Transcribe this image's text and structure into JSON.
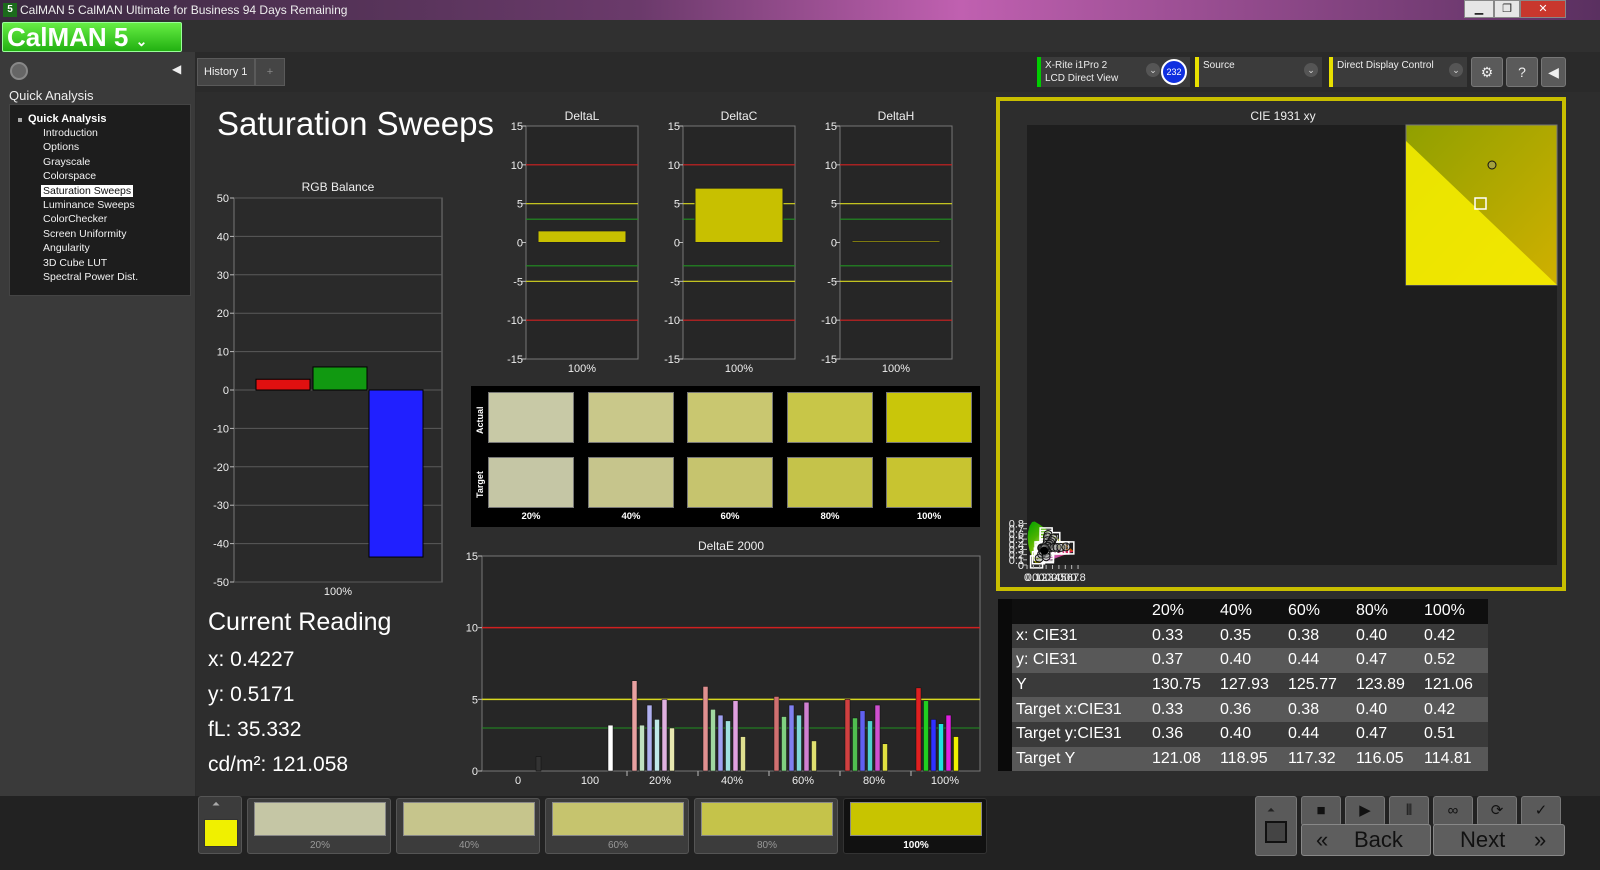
{
  "window": {
    "title": "CalMAN 5 CalMAN Ultimate for Business 94 Days Remaining",
    "app_icon": "5",
    "minimize": "▁",
    "maximize": "❐",
    "close": "✕"
  },
  "logo": "CalMAN 5",
  "sidebar": {
    "title": "Quick Analysis",
    "root": "Quick Analysis",
    "items": [
      {
        "label": "Introduction"
      },
      {
        "label": "Options"
      },
      {
        "label": "Grayscale"
      },
      {
        "label": "Colorspace"
      },
      {
        "label": "Saturation Sweeps",
        "selected": true
      },
      {
        "label": "Luminance Sweeps"
      },
      {
        "label": "ColorChecker"
      },
      {
        "label": "Screen Uniformity"
      },
      {
        "label": "Angularity"
      },
      {
        "label": "3D Cube LUT"
      },
      {
        "label": "Spectral Power Dist."
      }
    ]
  },
  "tabs": [
    {
      "label": "History 1"
    }
  ],
  "add_tab": "+",
  "devices": {
    "meter_line1": "X-Rite i1Pro 2",
    "meter_line2": "LCD Direct View",
    "meter_badge": "232",
    "source": "Source",
    "display": "Direct Display Control",
    "colors": {
      "meter": "#00cc00",
      "source": "#e8e000",
      "display": "#e8e000"
    }
  },
  "page_title": "Saturation Sweeps",
  "rgb_balance": {
    "title": "RGB Balance",
    "yticks": [
      "50",
      "40",
      "30",
      "20",
      "10",
      "0",
      "-10",
      "-20",
      "-30",
      "-40",
      "-50"
    ],
    "ymin": -50,
    "ymax": 50,
    "bars": [
      {
        "name": "red",
        "value": 2.8,
        "color": "#e01010"
      },
      {
        "name": "green",
        "value": 6.0,
        "color": "#119911"
      },
      {
        "name": "blue",
        "value": -43.5,
        "color": "#2020ff"
      }
    ],
    "xlabel": "100%"
  },
  "delta_charts": {
    "yticks": [
      "15",
      "10",
      "5",
      "0",
      "-5",
      "-10",
      "-15"
    ],
    "charts": [
      {
        "title": "DeltaL",
        "value": 1.5,
        "xlabel": "100%"
      },
      {
        "title": "DeltaC",
        "value": 7.0,
        "xlabel": "100%"
      },
      {
        "title": "DeltaH",
        "value": 0.2,
        "xlabel": "100%"
      }
    ]
  },
  "swatches": {
    "row_actual": "Actual",
    "row_target": "Target",
    "labels": [
      "20%",
      "40%",
      "60%",
      "80%",
      "100%"
    ],
    "actual": [
      "#c8c9a6",
      "#c9c88a",
      "#c9c770",
      "#c8c648",
      "#c9c60a"
    ],
    "target": [
      "#c5c6a5",
      "#c6c58c",
      "#c6c46e",
      "#c5c34a",
      "#c8c430"
    ]
  },
  "deltae": {
    "title": "DeltaE 2000",
    "yticks": [
      "15",
      "10",
      "5",
      "0"
    ],
    "xlabels": [
      "0",
      "100",
      "20%",
      "40%",
      "60%",
      "80%",
      "100%"
    ]
  },
  "reading": {
    "title": "Current Reading",
    "x": "x: 0.4227",
    "y": "y: 0.5171",
    "fl": "fL: 35.332",
    "cdm2": "cd/m²: 121.058"
  },
  "cie": {
    "title": "CIE 1931 xy",
    "xticks": [
      "0",
      "0.1",
      "0.2",
      "0.3",
      "0.4",
      "0.5",
      "0.6",
      "0.7",
      "0.8"
    ],
    "yticks": [
      "0",
      "0.1",
      "0.2",
      "0.3",
      "0.4",
      "0.5",
      "0.6",
      "0.7",
      "0.8"
    ]
  },
  "table": {
    "headers": [
      "20%",
      "40%",
      "60%",
      "80%",
      "100%"
    ],
    "rows": [
      {
        "label": "x: CIE31",
        "values": [
          "0.33",
          "0.35",
          "0.38",
          "0.40",
          "0.42"
        ]
      },
      {
        "label": "y: CIE31",
        "values": [
          "0.37",
          "0.40",
          "0.44",
          "0.47",
          "0.52"
        ]
      },
      {
        "label": "Y",
        "values": [
          "130.75",
          "127.93",
          "125.77",
          "123.89",
          "121.06"
        ]
      },
      {
        "label": "Target x:CIE31",
        "values": [
          "0.33",
          "0.36",
          "0.38",
          "0.40",
          "0.42"
        ]
      },
      {
        "label": "Target y:CIE31",
        "values": [
          "0.36",
          "0.40",
          "0.44",
          "0.47",
          "0.51"
        ]
      },
      {
        "label": "Target Y",
        "values": [
          "121.08",
          "118.95",
          "117.32",
          "116.05",
          "114.81"
        ]
      }
    ]
  },
  "bottom": {
    "current_color": "#f0f000",
    "patches": [
      {
        "label": "20%",
        "color": "#c5c6a5"
      },
      {
        "label": "40%",
        "color": "#c6c58c"
      },
      {
        "label": "60%",
        "color": "#c6c46e"
      },
      {
        "label": "80%",
        "color": "#c5c34a"
      },
      {
        "label": "100%",
        "color": "#c8c400"
      }
    ],
    "back": "Back",
    "next": "Next"
  }
}
